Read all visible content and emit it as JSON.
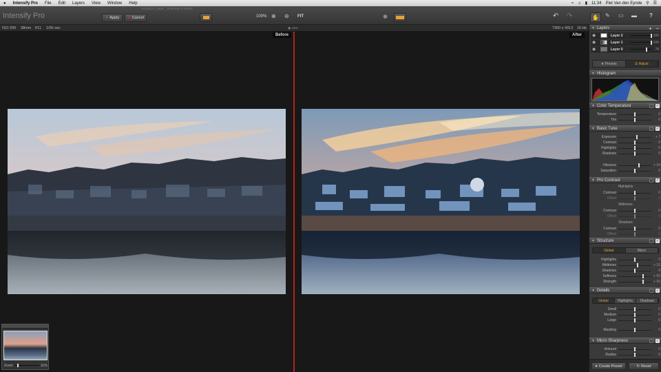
{
  "menubar": {
    "apple": "",
    "app_name": "Intensify Pro",
    "items": [
      "File",
      "Edit",
      "Layers",
      "View",
      "Window",
      "Help"
    ],
    "clock": "11:34",
    "user": "Piet Van den Eynde"
  },
  "toolbar": {
    "app_title": "Intensify Pro",
    "apply_label": "Apply",
    "cancel_label": "Cancel",
    "zoom_100": "100%",
    "fit_label": "FIT",
    "file_name": "20150101_0909 _ 0308 Edit-2-Edit.tif"
  },
  "infobar": {
    "iso": "ISO 200",
    "focal": "38mm",
    "aperture": "f/11",
    "shutter": "1/50 sec",
    "view_label": "view",
    "dimensions": "7360 x 4912",
    "bitdepth": "16-bit"
  },
  "canvas": {
    "before_label": "Before",
    "after_label": "After",
    "navigator": {
      "zoom_label": "Zoom",
      "zoom_value": "11%",
      "zoom_level": 0.11
    }
  },
  "right_panel": {
    "layers": {
      "title": "Layers",
      "items": [
        {
          "name": "Layer 2",
          "opacity": "100",
          "level": 1.0
        },
        {
          "name": "Layer 1",
          "opacity": "100",
          "level": 1.0
        },
        {
          "name": "Layer 0",
          "opacity": "78",
          "level": 0.78
        }
      ]
    },
    "tabs": {
      "presets": "Presets",
      "adjust": "Adjust"
    },
    "histogram": {
      "title": "Histogram"
    },
    "color_temperature": {
      "title": "Color Temperature",
      "sliders": [
        {
          "name": "Temperature",
          "value": "0",
          "level": 0.5
        },
        {
          "name": "Tint",
          "value": "0",
          "level": 0.5
        }
      ]
    },
    "basic_tune": {
      "title": "Basic Tune",
      "sliders": [
        {
          "name": "Exposure",
          "value": "+ 7",
          "level": 0.56
        },
        {
          "name": "Contrast",
          "value": "0",
          "level": 0.5
        },
        {
          "name": "Highlights",
          "value": "0",
          "level": 0.5
        },
        {
          "name": "Shadows",
          "value": "0",
          "level": 0.5
        },
        {
          "name": "Vibrance",
          "value": "+ 24",
          "level": 0.62
        },
        {
          "name": "Saturation",
          "value": "0",
          "level": 0.5
        }
      ]
    },
    "pro_contrast": {
      "title": "Pro Contrast",
      "groups": [
        {
          "heading": "Highlights",
          "contrast": "Contrast",
          "offset": "Offset"
        },
        {
          "heading": "Midtones",
          "contrast": "Contrast",
          "offset": "Offset"
        },
        {
          "heading": "Shadows",
          "contrast": "Contrast",
          "offset": "Offset"
        }
      ],
      "values": [
        "0",
        "0",
        "0",
        "0",
        "0",
        "0"
      ]
    },
    "structure": {
      "title": "Structure",
      "tabs": [
        "Global",
        "Micro"
      ],
      "sliders": [
        {
          "name": "Highlights",
          "value": "0",
          "level": 0.5
        },
        {
          "name": "Midtones",
          "value": "+ 15",
          "level": 0.58
        },
        {
          "name": "Shadows",
          "value": "0",
          "level": 0.5
        },
        {
          "name": "Softness",
          "value": "+ 50",
          "level": 0.75
        },
        {
          "name": "Strength",
          "value": "+ 50",
          "level": 0.75
        }
      ]
    },
    "details": {
      "title": "Details",
      "tabs": [
        "Global",
        "Highlights",
        "Shadows"
      ],
      "sliders": [
        {
          "name": "Small",
          "value": "0",
          "level": 0.5
        },
        {
          "name": "Medium",
          "value": "0",
          "level": 0.5
        },
        {
          "name": "Large",
          "value": "0",
          "level": 0.5
        },
        {
          "name": "Masking",
          "value": "0",
          "level": 0.5
        }
      ]
    },
    "micro_sharpness": {
      "title": "Micro Sharpness",
      "sliders": [
        {
          "name": "Amount",
          "value": "0",
          "level": 0.5
        },
        {
          "name": "Radius",
          "value": "0",
          "level": 0.5
        }
      ]
    },
    "footer": {
      "create_preset": "Create Preset",
      "reset": "Reset"
    }
  },
  "colors": {
    "accent": "#e6a335",
    "divider": "#b5241b",
    "panel": "#3a3a3a"
  }
}
